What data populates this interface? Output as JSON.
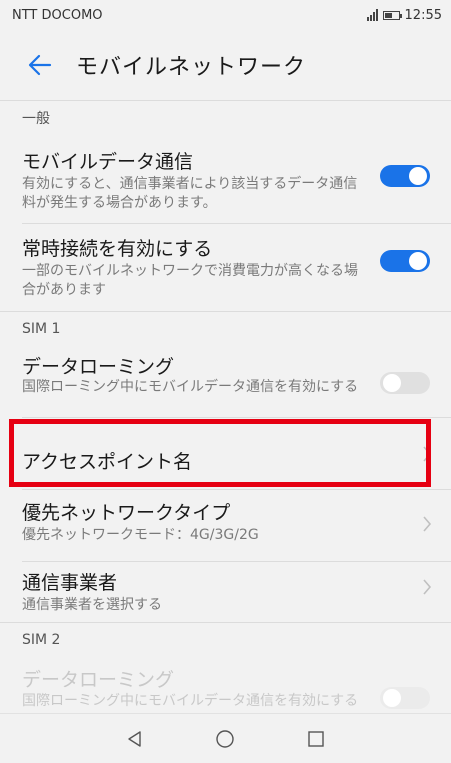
{
  "status_bar": {
    "carrier": "NTT DOCOMO",
    "time": "12:55"
  },
  "app_bar": {
    "title": "モバイルネットワーク"
  },
  "sections": {
    "general": "一般",
    "sim1": "SIM 1",
    "sim2": "SIM 2"
  },
  "rows": {
    "mobile_data": {
      "title": "モバイルデータ通信",
      "subtitle": "有効にすると、通信事業者により該当するデータ通信料が発生する場合があります。",
      "enabled": true
    },
    "always_on": {
      "title": "常時接続を有効にする",
      "subtitle": "一部のモバイルネットワークで消費電力が高くなる場合があります",
      "enabled": true
    },
    "sim1_roaming": {
      "title": "データローミング",
      "subtitle": "国際ローミング中にモバイルデータ通信を有効にする",
      "enabled": false
    },
    "apn": {
      "title": "アクセスポイント名"
    },
    "preferred_network": {
      "title": "優先ネットワークタイプ",
      "subtitle": "優先ネットワークモード：4G/3G/2G"
    },
    "carrier": {
      "title": "通信事業者",
      "subtitle": "通信事業者を選択する"
    },
    "sim2_roaming": {
      "title": "データローミング",
      "subtitle": "国際ローミング中にモバイルデータ通信を有効にする",
      "enabled": false
    }
  },
  "colors": {
    "accent": "#1a73e8",
    "highlight": "#e60012",
    "background": "#f2f2f2"
  },
  "icons": {
    "back": "arrow-left",
    "chevron": "chevron-right",
    "nav_back": "triangle-left",
    "nav_home": "circle",
    "nav_recent": "square"
  }
}
